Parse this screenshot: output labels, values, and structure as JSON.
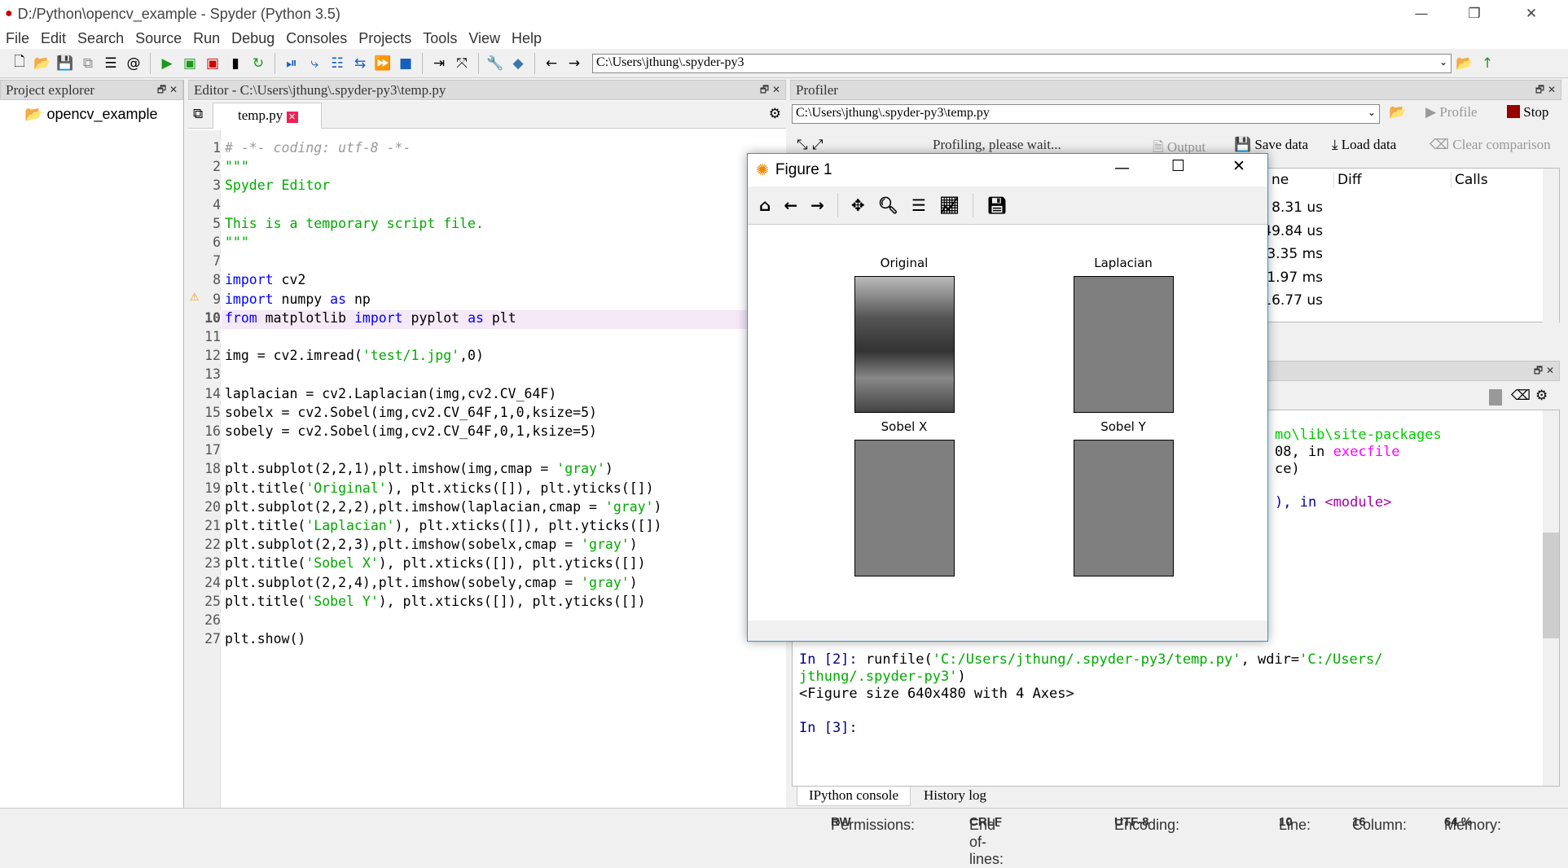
{
  "window": {
    "title": "D:/Python\\opencv_example - Spyder (Python 3.5)"
  },
  "menu": [
    "File",
    "Edit",
    "Search",
    "Source",
    "Run",
    "Debug",
    "Consoles",
    "Projects",
    "Tools",
    "View",
    "Help"
  ],
  "toolbar": {
    "path": "C:\\Users\\jthung\\.spyder-py3"
  },
  "explorer": {
    "title": "Project explorer",
    "item": "opencv_example"
  },
  "editor": {
    "title": "Editor - C:\\Users\\jthung\\.spyder-py3\\temp.py",
    "tab": "temp.py",
    "current_line": 10,
    "warning_line": 9,
    "lines": [
      "# -*- coding: utf-8 -*-",
      "\"\"\"",
      "Spyder Editor",
      "",
      "This is a temporary script file.",
      "\"\"\"",
      "",
      "import cv2",
      "import numpy as np",
      "from matplotlib import pyplot as plt",
      "",
      "img = cv2.imread('test/1.jpg',0)",
      "",
      "laplacian = cv2.Laplacian(img,cv2.CV_64F)",
      "sobelx = cv2.Sobel(img,cv2.CV_64F,1,0,ksize=5)",
      "sobely = cv2.Sobel(img,cv2.CV_64F,0,1,ksize=5)",
      "",
      "plt.subplot(2,2,1),plt.imshow(img,cmap = 'gray')",
      "plt.title('Original'), plt.xticks([]), plt.yticks([])",
      "plt.subplot(2,2,2),plt.imshow(laplacian,cmap = 'gray')",
      "plt.title('Laplacian'), plt.xticks([]), plt.yticks([])",
      "plt.subplot(2,2,3),plt.imshow(sobelx,cmap = 'gray')",
      "plt.title('Sobel X'), plt.xticks([]), plt.yticks([])",
      "plt.subplot(2,2,4),plt.imshow(sobely,cmap = 'gray')",
      "plt.title('Sobel Y'), plt.xticks([]), plt.yticks([])",
      "",
      "plt.show()"
    ]
  },
  "profiler": {
    "title": "Profiler",
    "file": "C:\\Users\\jthung\\.spyder-py3\\temp.py",
    "profile": "Profile",
    "stop": "Stop",
    "status": "Profiling, please wait...",
    "output": "Output",
    "save": "Save data",
    "load": "Load data",
    "clear": "Clear comparison",
    "columns": [
      "ne",
      "Diff",
      "Calls"
    ],
    "times": [
      "8.31 us",
      "49.84 us",
      "3.35 ms",
      "1.97 ms",
      "16.77 us"
    ]
  },
  "console": {
    "frag1": "mo\\lib\\site-packages",
    "frag2a": "08, in ",
    "frag2b": "execfile",
    "frag3": "ce)",
    "frag4a": "), in ",
    "frag4b": "<module>",
    "in2": "In [2]: ",
    "run1": "runfile(",
    "run2": "'C:/Users/jthung/.spyder-py3/temp.py'",
    "run3": ", wdir=",
    "run4": "'C:/Users/",
    "run5": "jthung/.spyder-py3'",
    "run6": ")",
    "out": "<Figure size 640x480 with 4 Axes>",
    "in3": "In [3]:",
    "tabs": [
      "IPython console",
      "History log"
    ]
  },
  "figure": {
    "title": "Figure 1",
    "axes": [
      "Original",
      "Laplacian",
      "Sobel X",
      "Sobel Y"
    ]
  },
  "status": {
    "permissions_label": "Permissions:",
    "permissions": "RW",
    "eol_label": "End-of-lines:",
    "eol": "CRLF",
    "enc_label": "Encoding:",
    "enc": "UTF-8",
    "line_label": "Line:",
    "line": "10",
    "col_label": "Column:",
    "col": "16",
    "mem_label": "Memory:",
    "mem": "64 %"
  }
}
